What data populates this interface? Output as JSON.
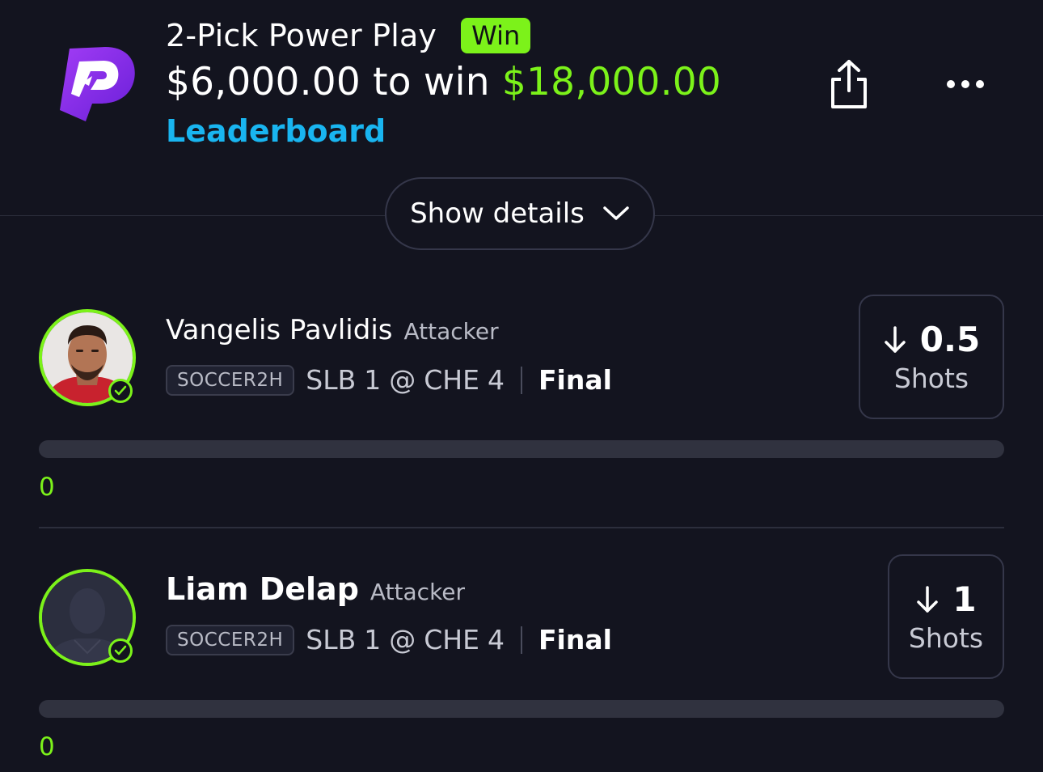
{
  "header": {
    "entry_type": "2-Pick Power Play",
    "result_badge": "Win",
    "wager": "$6,000.00",
    "to_win_text": "to win",
    "payout": "$18,000.00",
    "leaderboard_link": "Leaderboard",
    "share_icon": "share-icon",
    "more_icon": "more-horizontal-icon",
    "logo_icon": "prizepicks-logo"
  },
  "details": {
    "show_details_label": "Show details",
    "chevron_icon": "chevron-down-icon"
  },
  "picks": [
    {
      "player_name": "Vangelis Pavlidis",
      "position": "Attacker",
      "league": "SOCCER2H",
      "away_team": "SLB",
      "away_score": "1",
      "at": "@",
      "home_team": "CHE",
      "home_score": "4",
      "status": "Final",
      "direction_icon": "arrow-down-icon",
      "line": "0.5",
      "stat": "Shots",
      "actual": "0",
      "progress_fraction": 0,
      "avatar": "player-photo",
      "result": "hit"
    },
    {
      "player_name": "Liam Delap",
      "position": "Attacker",
      "league": "SOCCER2H",
      "away_team": "SLB",
      "away_score": "1",
      "at": "@",
      "home_team": "CHE",
      "home_score": "4",
      "status": "Final",
      "direction_icon": "arrow-down-icon",
      "line": "1",
      "stat": "Shots",
      "actual": "0",
      "progress_fraction": 0,
      "avatar": "player-silhouette",
      "result": "hit"
    }
  ],
  "colors": {
    "background": "#13141f",
    "accent_green": "#7cf21a",
    "link_blue": "#19b5f0",
    "logo_purple": "#8b2ff0"
  }
}
